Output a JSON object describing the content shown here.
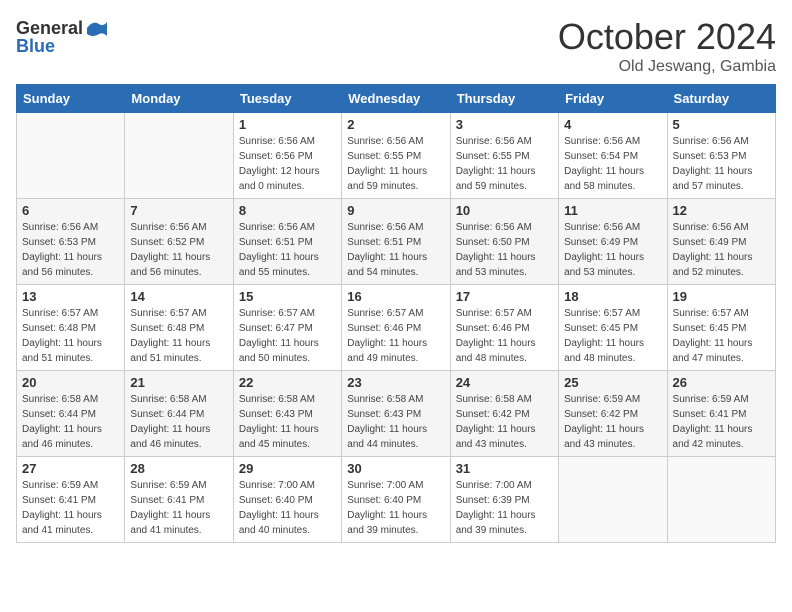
{
  "header": {
    "logo_general": "General",
    "logo_blue": "Blue",
    "month_title": "October 2024",
    "subtitle": "Old Jeswang, Gambia"
  },
  "weekdays": [
    "Sunday",
    "Monday",
    "Tuesday",
    "Wednesday",
    "Thursday",
    "Friday",
    "Saturday"
  ],
  "weeks": [
    [
      {
        "day": "",
        "info": ""
      },
      {
        "day": "",
        "info": ""
      },
      {
        "day": "1",
        "info": "Sunrise: 6:56 AM\nSunset: 6:56 PM\nDaylight: 12 hours\nand 0 minutes."
      },
      {
        "day": "2",
        "info": "Sunrise: 6:56 AM\nSunset: 6:55 PM\nDaylight: 11 hours\nand 59 minutes."
      },
      {
        "day": "3",
        "info": "Sunrise: 6:56 AM\nSunset: 6:55 PM\nDaylight: 11 hours\nand 59 minutes."
      },
      {
        "day": "4",
        "info": "Sunrise: 6:56 AM\nSunset: 6:54 PM\nDaylight: 11 hours\nand 58 minutes."
      },
      {
        "day": "5",
        "info": "Sunrise: 6:56 AM\nSunset: 6:53 PM\nDaylight: 11 hours\nand 57 minutes."
      }
    ],
    [
      {
        "day": "6",
        "info": "Sunrise: 6:56 AM\nSunset: 6:53 PM\nDaylight: 11 hours\nand 56 minutes."
      },
      {
        "day": "7",
        "info": "Sunrise: 6:56 AM\nSunset: 6:52 PM\nDaylight: 11 hours\nand 56 minutes."
      },
      {
        "day": "8",
        "info": "Sunrise: 6:56 AM\nSunset: 6:51 PM\nDaylight: 11 hours\nand 55 minutes."
      },
      {
        "day": "9",
        "info": "Sunrise: 6:56 AM\nSunset: 6:51 PM\nDaylight: 11 hours\nand 54 minutes."
      },
      {
        "day": "10",
        "info": "Sunrise: 6:56 AM\nSunset: 6:50 PM\nDaylight: 11 hours\nand 53 minutes."
      },
      {
        "day": "11",
        "info": "Sunrise: 6:56 AM\nSunset: 6:49 PM\nDaylight: 11 hours\nand 53 minutes."
      },
      {
        "day": "12",
        "info": "Sunrise: 6:56 AM\nSunset: 6:49 PM\nDaylight: 11 hours\nand 52 minutes."
      }
    ],
    [
      {
        "day": "13",
        "info": "Sunrise: 6:57 AM\nSunset: 6:48 PM\nDaylight: 11 hours\nand 51 minutes."
      },
      {
        "day": "14",
        "info": "Sunrise: 6:57 AM\nSunset: 6:48 PM\nDaylight: 11 hours\nand 51 minutes."
      },
      {
        "day": "15",
        "info": "Sunrise: 6:57 AM\nSunset: 6:47 PM\nDaylight: 11 hours\nand 50 minutes."
      },
      {
        "day": "16",
        "info": "Sunrise: 6:57 AM\nSunset: 6:46 PM\nDaylight: 11 hours\nand 49 minutes."
      },
      {
        "day": "17",
        "info": "Sunrise: 6:57 AM\nSunset: 6:46 PM\nDaylight: 11 hours\nand 48 minutes."
      },
      {
        "day": "18",
        "info": "Sunrise: 6:57 AM\nSunset: 6:45 PM\nDaylight: 11 hours\nand 48 minutes."
      },
      {
        "day": "19",
        "info": "Sunrise: 6:57 AM\nSunset: 6:45 PM\nDaylight: 11 hours\nand 47 minutes."
      }
    ],
    [
      {
        "day": "20",
        "info": "Sunrise: 6:58 AM\nSunset: 6:44 PM\nDaylight: 11 hours\nand 46 minutes."
      },
      {
        "day": "21",
        "info": "Sunrise: 6:58 AM\nSunset: 6:44 PM\nDaylight: 11 hours\nand 46 minutes."
      },
      {
        "day": "22",
        "info": "Sunrise: 6:58 AM\nSunset: 6:43 PM\nDaylight: 11 hours\nand 45 minutes."
      },
      {
        "day": "23",
        "info": "Sunrise: 6:58 AM\nSunset: 6:43 PM\nDaylight: 11 hours\nand 44 minutes."
      },
      {
        "day": "24",
        "info": "Sunrise: 6:58 AM\nSunset: 6:42 PM\nDaylight: 11 hours\nand 43 minutes."
      },
      {
        "day": "25",
        "info": "Sunrise: 6:59 AM\nSunset: 6:42 PM\nDaylight: 11 hours\nand 43 minutes."
      },
      {
        "day": "26",
        "info": "Sunrise: 6:59 AM\nSunset: 6:41 PM\nDaylight: 11 hours\nand 42 minutes."
      }
    ],
    [
      {
        "day": "27",
        "info": "Sunrise: 6:59 AM\nSunset: 6:41 PM\nDaylight: 11 hours\nand 41 minutes."
      },
      {
        "day": "28",
        "info": "Sunrise: 6:59 AM\nSunset: 6:41 PM\nDaylight: 11 hours\nand 41 minutes."
      },
      {
        "day": "29",
        "info": "Sunrise: 7:00 AM\nSunset: 6:40 PM\nDaylight: 11 hours\nand 40 minutes."
      },
      {
        "day": "30",
        "info": "Sunrise: 7:00 AM\nSunset: 6:40 PM\nDaylight: 11 hours\nand 39 minutes."
      },
      {
        "day": "31",
        "info": "Sunrise: 7:00 AM\nSunset: 6:39 PM\nDaylight: 11 hours\nand 39 minutes."
      },
      {
        "day": "",
        "info": ""
      },
      {
        "day": "",
        "info": ""
      }
    ]
  ]
}
